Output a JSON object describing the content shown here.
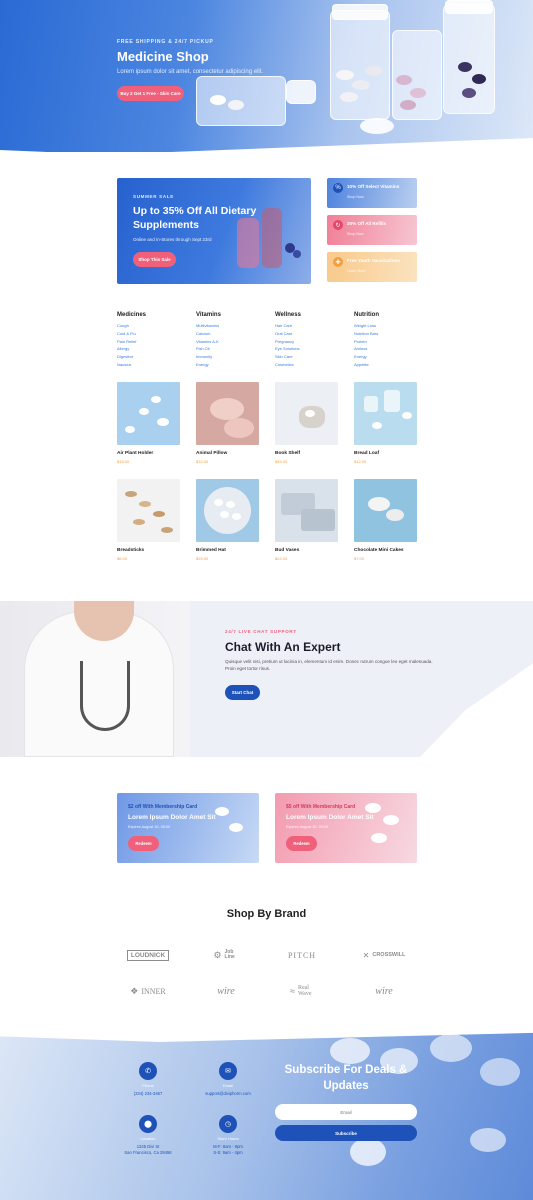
{
  "hero": {
    "eyebrow": "FREE SHIPPING & 24/7 PICKUP",
    "title": "Medicine Shop",
    "subtitle": "Lorem ipsum dolor sit amet, consectetur adipiscing elit.",
    "button": "Buy 2 Get 1 Free - Skin Care"
  },
  "promo": {
    "eyebrow": "SUMMER SALE",
    "title": "Up to 35% Off All Dietary Supplements",
    "subtitle": "Online and In-Stores through Sept 23rd",
    "button": "Shop This Sale",
    "cards": [
      {
        "title": "10% Off Select Vitamins",
        "link": "Shop Now"
      },
      {
        "title": "20% Off All Refills",
        "link": "Shop Now"
      },
      {
        "title": "Free Youth Vaccinations",
        "link": "Learn More"
      }
    ]
  },
  "categories": [
    {
      "title": "Medicines",
      "links": [
        "Cough",
        "Cold & Flu",
        "Pain Relief",
        "Allergy",
        "Digestive",
        "Nausea"
      ]
    },
    {
      "title": "Vitamins",
      "links": [
        "Multivitamins",
        "Calcium",
        "Vitamins A-K",
        "Fish Oil",
        "Immunity",
        "Energy"
      ]
    },
    {
      "title": "Wellness",
      "links": [
        "Hair Care",
        "Oral Care",
        "Pregnancy",
        "Eye Solutions",
        "Skin Care",
        "Cosmetics"
      ]
    },
    {
      "title": "Nutrition",
      "links": [
        "Weight Loss",
        "Nutrition Bars",
        "Protein",
        "Aminos",
        "Energy",
        "Appetite"
      ]
    }
  ],
  "products": [
    {
      "name": "Air Plant Holder",
      "price": "$18.00"
    },
    {
      "name": "Animal Pillow",
      "price": "$32.00"
    },
    {
      "name": "Book Shelf",
      "price": "$49.00"
    },
    {
      "name": "Bread Loaf",
      "price": "$12.00"
    },
    {
      "name": "Breadsticks",
      "price": "$6.00"
    },
    {
      "name": "Brimmed Hat",
      "price": "$25.00"
    },
    {
      "name": "Bud Vases",
      "price": "$22.00"
    },
    {
      "name": "Chocolate Mini Cakes",
      "price": "$7.00"
    }
  ],
  "chat": {
    "eyebrow": "24/7 LIVE CHAT SUPPORT",
    "title": "Chat With An Expert",
    "body": "Quisque velit nisi, pretium ut lacinia in, elementum id enim. Donec rutrum congue leo eget malesuada. Proin eget tortor risus.",
    "button": "Start Chat"
  },
  "membership": [
    {
      "tag": "$2 off With Membership Card",
      "headline": "Lorem Ipsum Dolor Amet Sit",
      "expiry": "Expires August 30, 09:00",
      "button": "Redeem"
    },
    {
      "tag": "$5 off With Membership Card",
      "headline": "Lorem Ipsum Dolor Amet Sit",
      "expiry": "Expires August 30, 09:00",
      "button": "Redeem"
    }
  ],
  "brands": {
    "title": "Shop By Brand",
    "items": [
      "LOUDNICK",
      "Job Line",
      "PITCH",
      "CROSSWILL",
      "INNER",
      "wire",
      "Real Wave",
      "wire"
    ]
  },
  "footer": {
    "phone_label": "Phone",
    "phone": "(234) 234-3467",
    "email_label": "Email",
    "email": "support@diviphorm.com",
    "location_label": "Location",
    "address_line1": "1345 Divi St",
    "address_line2": "San Francisco, Ca 29456",
    "hours_label": "Store Hours",
    "hours_line1": "M-F: 8am - 9pm",
    "hours_line2": "S-S: 9am - 4pm",
    "subscribe_title": "Subscribe For Deals & Updates",
    "email_placeholder": "Email",
    "subscribe_button": "Subscribe"
  },
  "colors": {
    "primary_blue": "#1f52b8",
    "accent_pink": "#f0607b",
    "price_orange": "#f5a142",
    "link_blue": "#3a7ae0"
  }
}
